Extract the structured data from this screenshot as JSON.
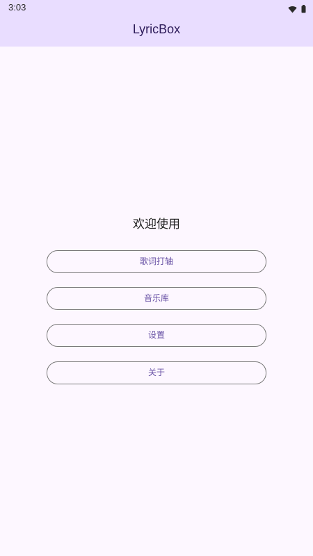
{
  "status_bar": {
    "time": "3:03",
    "icons": [
      "wifi-icon",
      "battery-icon"
    ]
  },
  "app_bar": {
    "title": "LyricBox"
  },
  "main": {
    "welcome": "欢迎使用",
    "buttons": [
      {
        "label": "歌词打轴"
      },
      {
        "label": "音乐库"
      },
      {
        "label": "设置"
      },
      {
        "label": "关于"
      }
    ]
  },
  "colors": {
    "app_bar_bg": "#e9ddff",
    "background": "#fdf7ff",
    "button_text": "#6750a4",
    "title_text": "#2d1b5a"
  }
}
